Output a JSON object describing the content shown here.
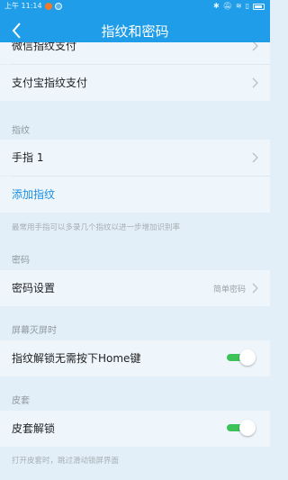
{
  "status_bar": {
    "time": "上午 11:14",
    "icons": [
      "bluetooth-icon",
      "mute-icon",
      "wifi-icon",
      "sim-icon",
      "battery-icon"
    ]
  },
  "header": {
    "title": "指纹和密码",
    "back_icon": "chevron-left-icon"
  },
  "sections": {
    "top_rows": [
      "微信指纹支付",
      "支付宝指纹支付"
    ],
    "fingerprint": {
      "title": "指纹",
      "finger_label": "手指 1",
      "add_label": "添加指纹",
      "hint": "最常用手指可以多录几个指纹以进一步增加识别率"
    },
    "password": {
      "title": "密码",
      "setting_label": "密码设置",
      "setting_value": "简单密码"
    },
    "screen_off": {
      "title": "屏幕灭屏时",
      "unlock_label": "指纹解锁无需按下Home键",
      "unlock_enabled": true
    },
    "cover": {
      "title": "皮套",
      "unlock_label": "皮套解锁",
      "unlock_enabled": true,
      "hint": "打开皮套时，跳过滑动锁屏界面"
    }
  },
  "colors": {
    "accent": "#1f9de8",
    "link": "#1b8fe0",
    "toggle_on": "#3dc25a",
    "background": "#e3eff8"
  }
}
